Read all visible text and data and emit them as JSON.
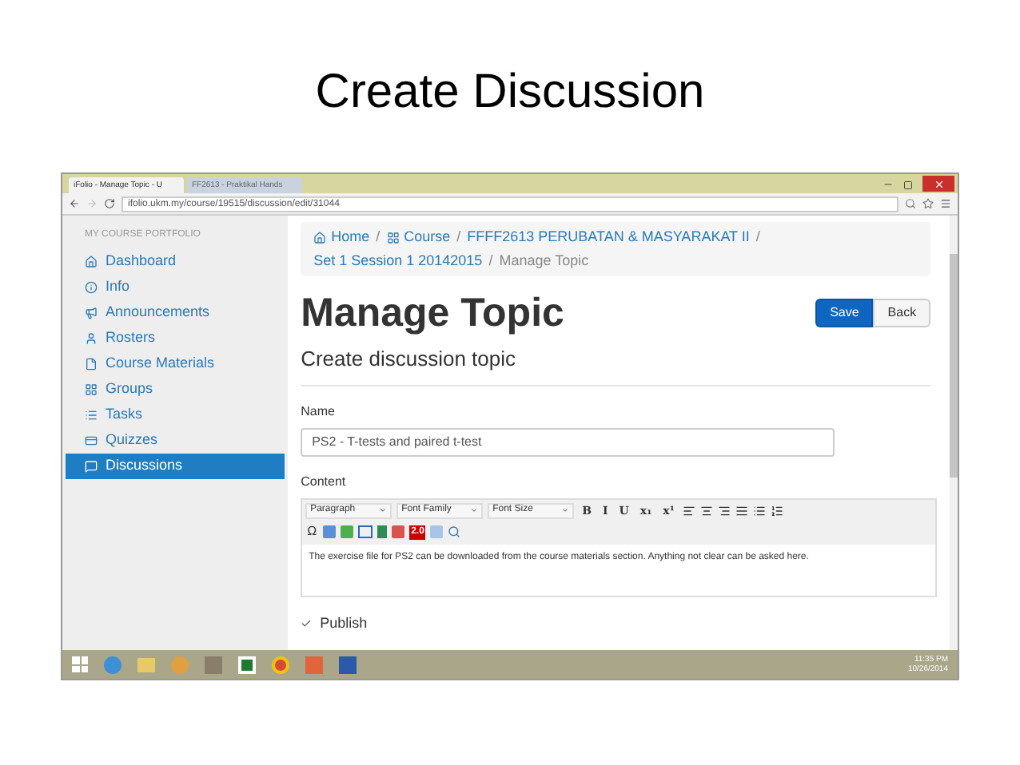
{
  "slide_title": "Create Discussion",
  "browser": {
    "tabs": [
      {
        "label": "iFolio - Manage Topic - U",
        "selected": true
      },
      {
        "label": "FF2613 - Praktikal Hands",
        "selected": false
      }
    ],
    "url": "ifolio.ukm.my/course/19515/discussion/edit/31044"
  },
  "sidebar": {
    "heading": "MY COURSE PORTFOLIO",
    "items": [
      {
        "label": "Dashboard",
        "selected": false
      },
      {
        "label": "Info",
        "selected": false
      },
      {
        "label": "Announcements",
        "selected": false
      },
      {
        "label": "Rosters",
        "selected": false
      },
      {
        "label": "Course Materials",
        "selected": false
      },
      {
        "label": "Groups",
        "selected": false
      },
      {
        "label": "Tasks",
        "selected": false
      },
      {
        "label": "Quizzes",
        "selected": false
      },
      {
        "label": "Discussions",
        "selected": true
      }
    ]
  },
  "breadcrumb": {
    "separator": "/",
    "lines": [
      [
        {
          "label": "Home",
          "current": false
        },
        {
          "label": "Course",
          "current": false
        },
        {
          "label": "FFFF2613 PERUBATAN & MASYARAKAT II",
          "current": false
        }
      ],
      [
        {
          "label": "Set 1 Session 1 20142015",
          "current": false
        },
        {
          "label": "Manage Topic",
          "current": true
        }
      ]
    ]
  },
  "page": {
    "title": "Manage Topic",
    "subtitle": "Create discussion topic",
    "buttons": [
      {
        "label": "Save",
        "kind": "primary"
      },
      {
        "label": "Back",
        "kind": "default"
      }
    ]
  },
  "form": {
    "name_label": "Name",
    "name_value": "PS2 - T-tests and paired t-test",
    "content_label": "Content",
    "toolbar": {
      "selects": [
        "Paragraph",
        "Font Family",
        "Font Size"
      ],
      "format_buttons": [
        "B",
        "I",
        "U",
        "x₁",
        "x¹"
      ],
      "symbol": "Ω",
      "badge": "2.0"
    },
    "content_text": "The exercise file for PS2 can be downloaded from the course materials section. Anything not clear can be asked here.",
    "publish": {
      "label": "Publish",
      "checked": true
    }
  },
  "taskbar": {
    "time": "11:35 PM",
    "date": "10/26/2014"
  }
}
